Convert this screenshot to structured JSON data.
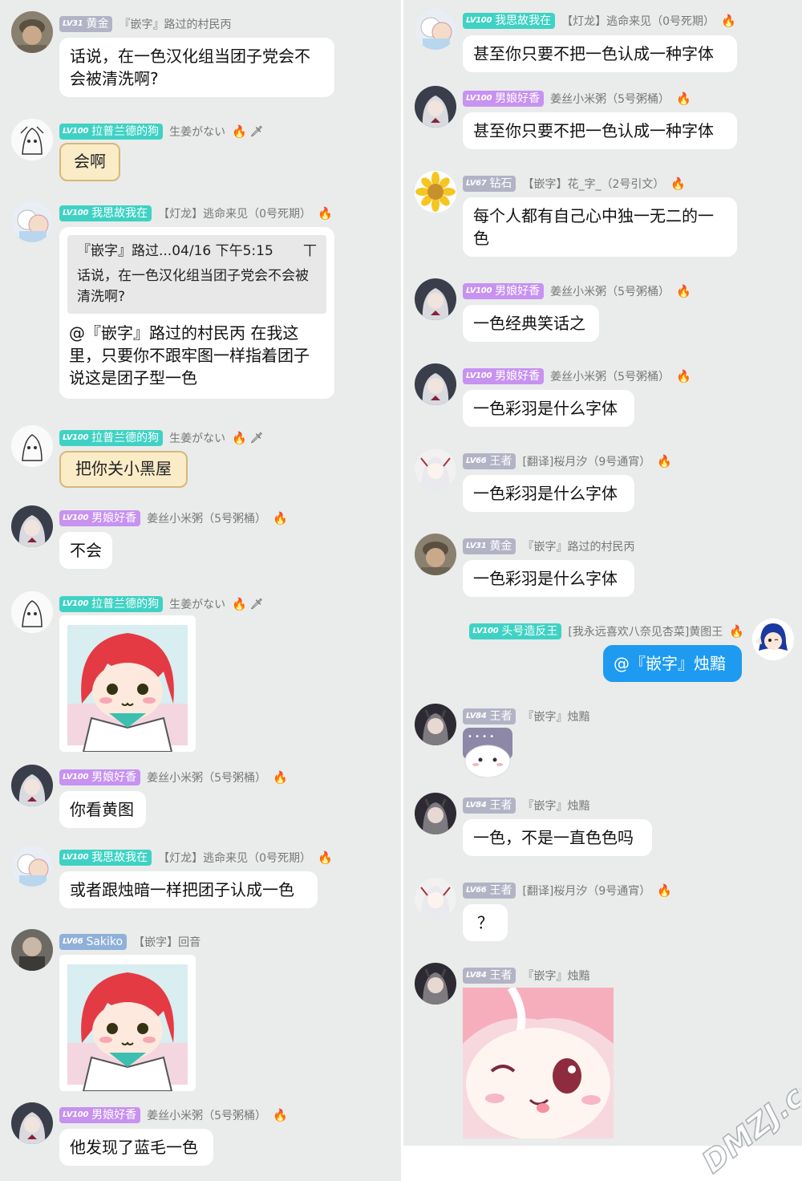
{
  "colors": {
    "lv_gold": "#b7b7c8",
    "lv_cyan": "#3fd2c4",
    "lv_purple": "#c792f0",
    "lv_blue": "#8fb0d8",
    "bubble_blue": "#1e9bf0"
  },
  "left": [
    {
      "lv": "LV31",
      "name": "黄金",
      "title": "『嵌字』路过的村民丙",
      "msg": "话说，在一色汉化组当团子党会不会被清洗啊?"
    },
    {
      "lv": "LV100",
      "name": "拉普兰德的狗",
      "title": "生姜がない",
      "msg": "会啊"
    },
    {
      "lv": "LV100",
      "name": "我思故我在",
      "title": "【灯龙】逃命来见（0号死期）",
      "quote": {
        "head": "『嵌字』路过...04/16 下午5:15",
        "text": "话说，在一色汉化组当团子党会不会被清洗啊?"
      },
      "msg": "@『嵌字』路过的村民丙 在我这里，只要你不跟牢图一样指着团子说这是团子型一色"
    },
    {
      "lv": "LV100",
      "name": "拉普兰德的狗",
      "title": "生姜がない",
      "msg": "把你关小黑屋"
    },
    {
      "lv": "LV100",
      "name": "男娘好香",
      "title": "姜丝小米粥（5号粥桶）",
      "msg": "不会"
    },
    {
      "lv": "LV100",
      "name": "拉普兰德的狗",
      "title": "生姜がない"
    },
    {
      "lv": "LV100",
      "name": "男娘好香",
      "title": "姜丝小米粥（5号粥桶）",
      "msg": "你看黄图"
    },
    {
      "lv": "LV100",
      "name": "我思故我在",
      "title": "【灯龙】逃命来见（0号死期）",
      "msg": "或者跟烛暗一样把团子认成一色"
    },
    {
      "lv": "LV66",
      "name": "Sakiko",
      "title": "【嵌字】回音"
    },
    {
      "lv": "LV100",
      "name": "男娘好香",
      "title": "姜丝小米粥（5号粥桶）",
      "msg": "他发现了蓝毛一色"
    }
  ],
  "right": [
    {
      "lv": "LV100",
      "name": "我思故我在",
      "title": "【灯龙】逃命来见（0号死期）",
      "msg": "甚至你只要不把一色认成一种字体"
    },
    {
      "lv": "LV100",
      "name": "男娘好香",
      "title": "姜丝小米粥（5号粥桶）",
      "msg": "甚至你只要不把一色认成一种字体"
    },
    {
      "lv": "LV67",
      "name": "钻石",
      "title": "【嵌字】花_字_（2号引文）",
      "msg": "每个人都有自己心中独一无二的一色"
    },
    {
      "lv": "LV100",
      "name": "男娘好香",
      "title": "姜丝小米粥（5号粥桶）",
      "msg": "一色经典笑话之"
    },
    {
      "lv": "LV100",
      "name": "男娘好香",
      "title": "姜丝小米粥（5号粥桶）",
      "msg": "一色彩羽是什么字体"
    },
    {
      "lv": "LV66",
      "name": "王者",
      "title": "[翻译]桜月汐（9号通宵）",
      "msg": "一色彩羽是什么字体"
    },
    {
      "lv": "LV31",
      "name": "黄金",
      "title": "『嵌字』路过的村民丙",
      "msg": "一色彩羽是什么字体"
    },
    {
      "lv": "LV100",
      "name": "头号造反王",
      "title": "[我永远喜欢八奈见杏菜]黄图王",
      "msg": "@『嵌字』烛黯"
    },
    {
      "lv": "LV84",
      "name": "王者",
      "title": "『嵌字』烛黯"
    },
    {
      "lv": "LV84",
      "name": "王者",
      "title": "『嵌字』烛黯",
      "msg": "一色，不是一直色色吗"
    },
    {
      "lv": "LV66",
      "name": "王者",
      "title": "[翻译]桜月汐（9号通宵）",
      "msg": "？"
    },
    {
      "lv": "LV84",
      "name": "王者",
      "title": "『嵌字』烛黯"
    }
  ],
  "watermark": "DMZJ.com"
}
